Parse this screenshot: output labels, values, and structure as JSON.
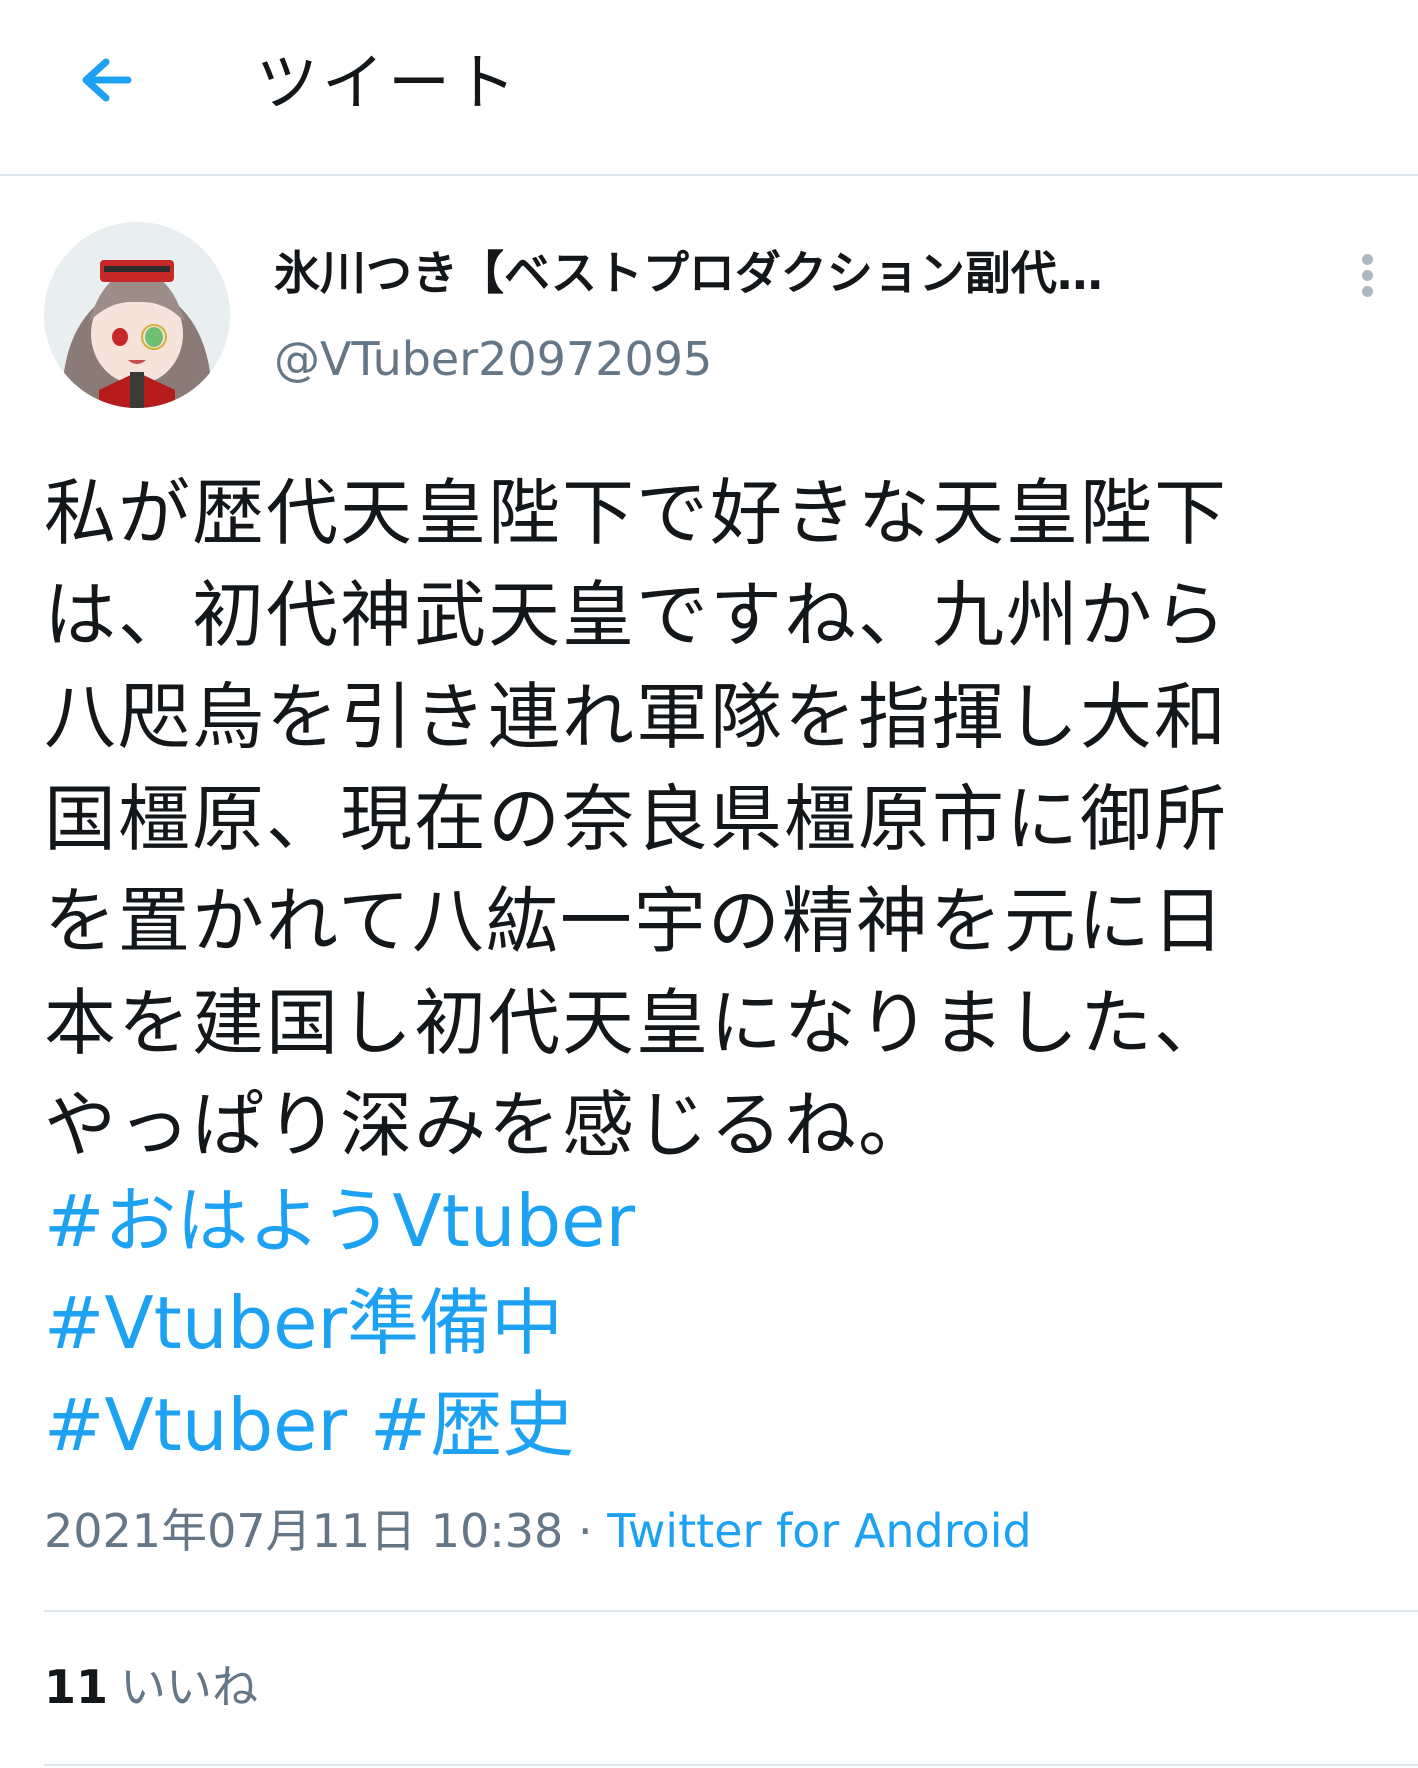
{
  "header": {
    "title": "ツイート",
    "back_icon": "back-arrow-icon",
    "accent_color": "#1da1f2"
  },
  "tweet": {
    "author": {
      "display_name": "氷川つき【ベストプロダクション副代…",
      "handle": "@VTuber20972095"
    },
    "text": "私が歴代天皇陛下で好きな天皇陛下\nは、初代神武天皇ですね、九州から\n八咫烏を引き連れ軍隊を指揮し大和\n国橿原、現在の奈良県橿原市に御所\nを置かれて八紘一宇の精神を元に日\n本を建国し初代天皇になりました、\nやっぱり深みを感じるね。",
    "hashtags": {
      "line1": [
        "#おはようVtuber"
      ],
      "line2": [
        "#Vtuber準備中"
      ],
      "line3": [
        "#Vtuber",
        "#歴史"
      ]
    },
    "timestamp": "2021年07月11日 10:38",
    "separator": "·",
    "source": "Twitter for Android",
    "likes": {
      "count": "11",
      "label": "いいね"
    }
  }
}
